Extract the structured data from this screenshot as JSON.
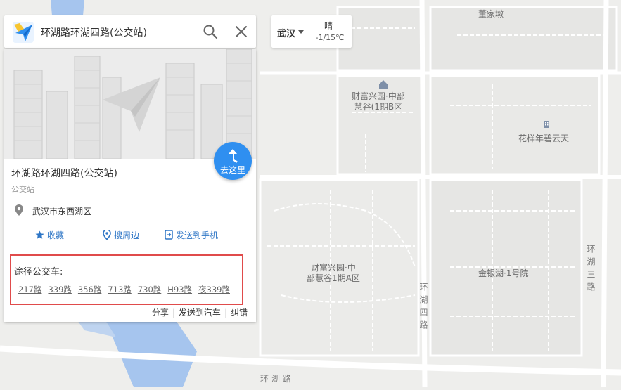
{
  "search": {
    "query": "环湖路环湖四路(公交站)"
  },
  "weather": {
    "city": "武汉",
    "condition": "晴",
    "temperature": "-1/15℃"
  },
  "panel": {
    "go_button": "去这里",
    "place_name": "环湖路环湖四路(公交站)",
    "place_type": "公交站",
    "address": "武汉市东西湖区",
    "actions": {
      "favorite": "收藏",
      "nearby": "搜周边",
      "send_phone": "发送到手机"
    },
    "bus": {
      "title": "途径公交车:",
      "routes": [
        "217路",
        "339路",
        "356路",
        "713路",
        "730路",
        "H93路",
        "夜339路"
      ]
    },
    "footer": {
      "share": "分享",
      "send_car": "发送到汽车",
      "report": "纠错"
    }
  },
  "map": {
    "labels": {
      "top": "董家墩",
      "caifu_b": "财富兴园·中部\n慧谷(1期B区",
      "huayang": "花样年碧云天",
      "caifu_a": "财富兴园·中\n部慧谷1期A区",
      "jinyinhu": "金银湖·1号院",
      "road_huanhu4": "环湖四路",
      "road_huanhu3": "环湖三路",
      "road_huanhu": "环 湖 路"
    },
    "colors": {
      "land": "#eeeeec",
      "water": "#a6c5ee",
      "road": "#ffffff",
      "accent": "#2f8ff0",
      "highlight": "#e04b4b"
    }
  }
}
